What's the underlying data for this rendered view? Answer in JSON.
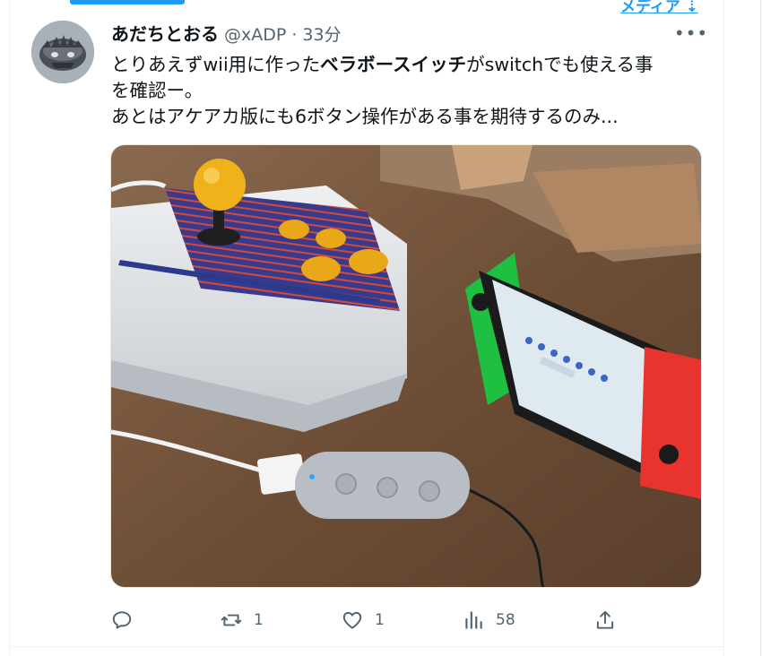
{
  "tabs": {
    "media_label": "メディア ⇣",
    "accent": "#1d9bf0"
  },
  "tweet": {
    "display_name": "あだちとおる",
    "handle": "@xADP",
    "separator": "·",
    "time": "33分",
    "more_label": "•••",
    "text": {
      "line1_pre": "とりあえずwii用に作った",
      "line1_bold": "ベラボースイッチ",
      "line1_post": "がswitchでも使える事",
      "line2": "を確認ー。",
      "line3": "あとはアケアカ版にも6ボタン操作がある事を期待するのみ..."
    },
    "photo_alt": "arcade-stick-and-switch-photo"
  },
  "actions": {
    "reply": {
      "icon": "reply-icon",
      "count": ""
    },
    "retweet": {
      "icon": "retweet-icon",
      "count": "1"
    },
    "like": {
      "icon": "heart-icon",
      "count": "1"
    },
    "views": {
      "icon": "analytics-icon",
      "count": "58"
    },
    "share": {
      "icon": "share-icon",
      "count": ""
    }
  },
  "colors": {
    "text": "#0f1419",
    "secondary": "#536471",
    "border": "#eff3f4"
  }
}
